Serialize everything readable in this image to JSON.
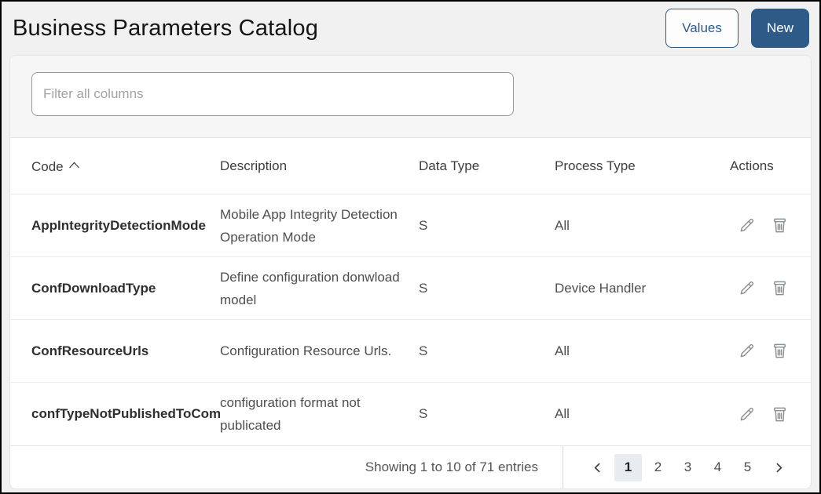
{
  "header": {
    "title": "Business Parameters Catalog",
    "values_button": "Values",
    "new_button": "New"
  },
  "filter": {
    "placeholder": "Filter all columns"
  },
  "table": {
    "columns": [
      {
        "label": "Code",
        "sort": "asc",
        "sort_icon": "chevron-up"
      },
      {
        "label": "Description"
      },
      {
        "label": "Data Type"
      },
      {
        "label": "Process Type"
      },
      {
        "label": "Actions"
      }
    ],
    "row_action_icons": [
      "edit-pencil-icon",
      "delete-trash-icon"
    ],
    "rows": [
      {
        "code": "AppIntegrityDetectionMode",
        "description": "Mobile App Integrity Detection Operation Mode",
        "data_type": "S",
        "process_type": "All"
      },
      {
        "code": "ConfDownloadType",
        "description": "Define configuration donwload model",
        "data_type": "S",
        "process_type": "Device Handler"
      },
      {
        "code": "ConfResourceUrls",
        "description": "Configuration Resource Urls.",
        "data_type": "S",
        "process_type": "All"
      },
      {
        "code": "confTypeNotPublishedToCom",
        "description": "configuration format not publicated",
        "data_type": "S",
        "process_type": "All"
      }
    ]
  },
  "footer": {
    "showing_text": "Showing 1 to 10 of 71 entries",
    "pages": [
      "1",
      "2",
      "3",
      "4",
      "5"
    ],
    "active_page": "1",
    "prev_icon": "chevron-left",
    "next_icon": "chevron-right"
  },
  "colors": {
    "accent_blue": "#2e5a87",
    "icon_gray": "#8a8f94",
    "active_page_bg": "#e8ecf1"
  }
}
